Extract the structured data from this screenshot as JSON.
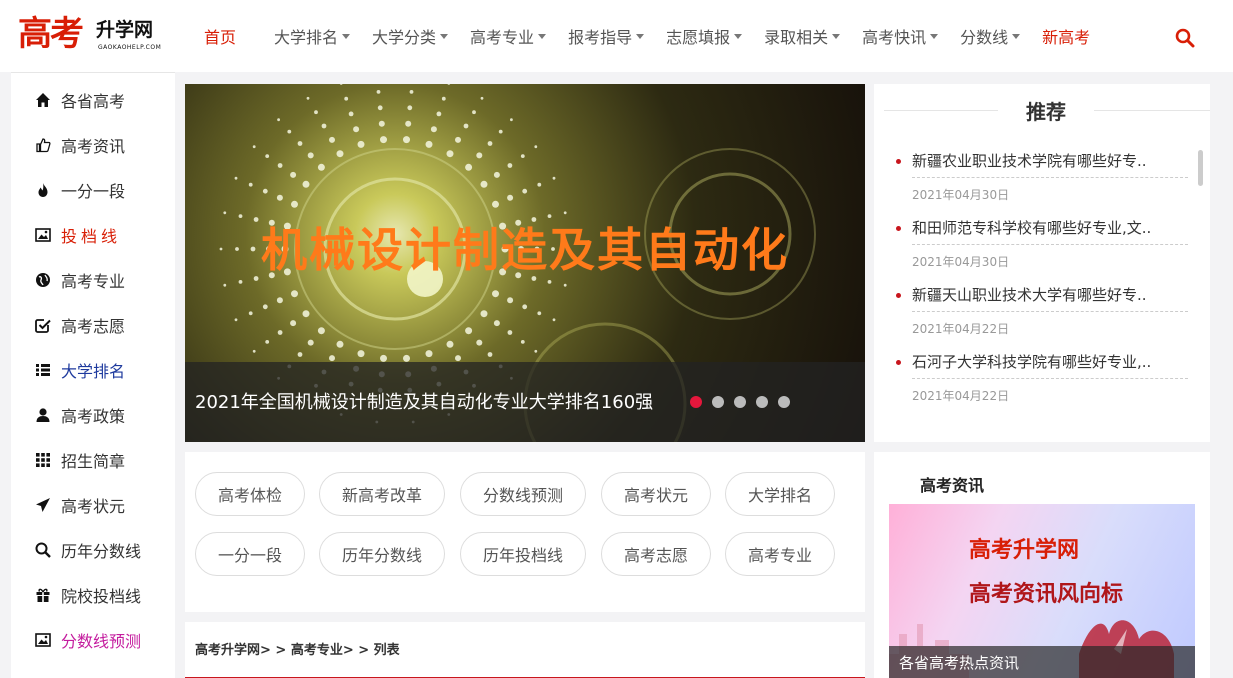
{
  "logo": {
    "cn_big": "高考",
    "cn_small": "升学网",
    "en": "GAOKAOHELP.COM"
  },
  "nav": {
    "home": "首页",
    "items": [
      "大学排名",
      "大学分类",
      "高考专业",
      "报考指导",
      "志愿填报",
      "录取相关",
      "高考快讯",
      "分数线"
    ],
    "new_gaokao": "新高考"
  },
  "sidebar": {
    "items": [
      {
        "label": "各省高考",
        "icon": "home-icon"
      },
      {
        "label": "高考资讯",
        "icon": "thumbs-up-icon"
      },
      {
        "label": "一分一段",
        "icon": "fire-icon"
      },
      {
        "label": "投档线",
        "icon": "image-icon"
      },
      {
        "label": "高考专业",
        "icon": "globe-icon"
      },
      {
        "label": "高考志愿",
        "icon": "check-square-icon"
      },
      {
        "label": "大学排名",
        "icon": "list-icon"
      },
      {
        "label": "高考政策",
        "icon": "user-icon"
      },
      {
        "label": "招生简章",
        "icon": "grid-icon"
      },
      {
        "label": "高考状元",
        "icon": "send-icon"
      },
      {
        "label": "历年分数线",
        "icon": "search-icon"
      },
      {
        "label": "院校投档线",
        "icon": "gift-icon"
      },
      {
        "label": "分数线预测",
        "icon": "picture-icon"
      }
    ],
    "colors": {
      "red": "#d81e06",
      "blue": "#1e3a9e",
      "pink": "#c41c9e"
    }
  },
  "banner": {
    "title": "机械设计制造及其自动化",
    "caption": "2021年全国机械设计制造及其自动化专业大学排名160强",
    "slide_count": 5,
    "active_slide": 1
  },
  "tags": [
    "高考体检",
    "新高考改革",
    "分数线预测",
    "高考状元",
    "大学排名",
    "一分一段",
    "历年分数线",
    "历年投档线",
    "高考志愿",
    "高考专业"
  ],
  "breadcrumb": "高考升学网> > 高考专业> > 列表",
  "recommend": {
    "title": "推荐",
    "items": [
      {
        "title": "新疆农业职业技术学院有哪些好专..",
        "date": "2021年04月30日"
      },
      {
        "title": "和田师范专科学校有哪些好专业,文..",
        "date": "2021年04月30日"
      },
      {
        "title": "新疆天山职业技术大学有哪些好专..",
        "date": "2021年04月22日"
      },
      {
        "title": "石河子大学科技学院有哪些好专业,..",
        "date": "2021年04月22日"
      }
    ]
  },
  "news": {
    "title": "高考资讯",
    "image_line1": "高考升学网",
    "image_line2": "高考资讯风向标",
    "caption": "各省高考热点资讯"
  },
  "colors": {
    "accent": "#d81e06",
    "dot_active": "#e5173c"
  }
}
